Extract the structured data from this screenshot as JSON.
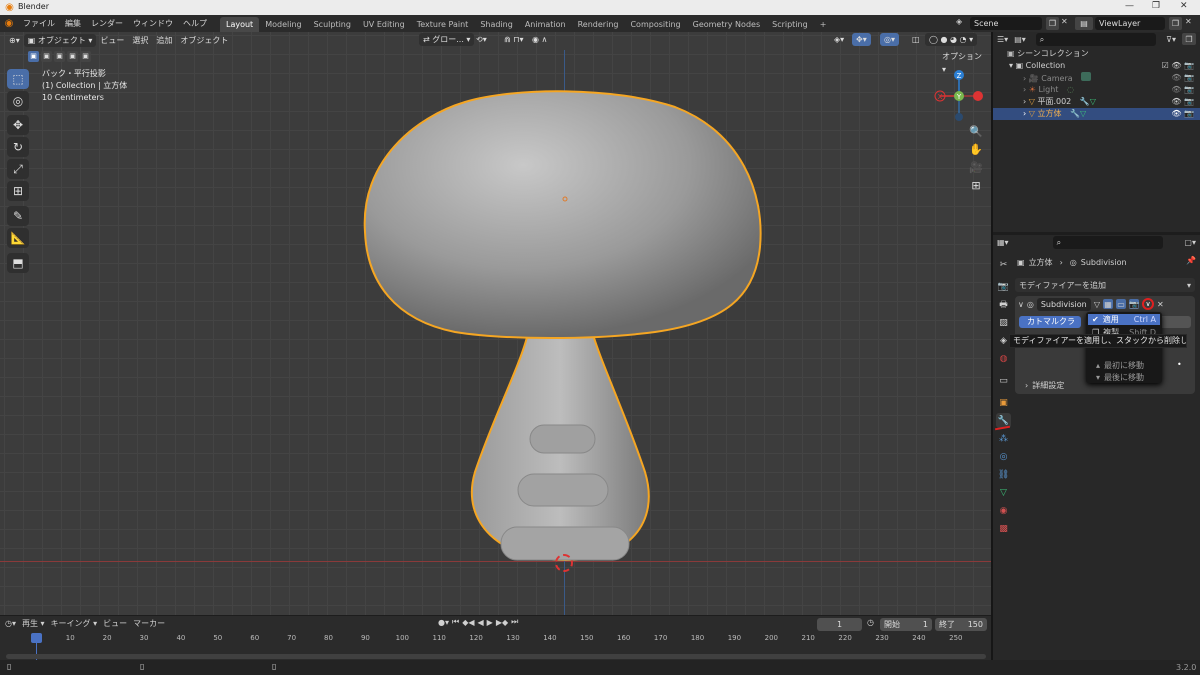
{
  "app": {
    "title": "Blender",
    "version": "3.2.0"
  },
  "menus": [
    "ファイル",
    "編集",
    "レンダー",
    "ウィンドウ",
    "ヘルプ"
  ],
  "workspaces": [
    "Layout",
    "Modeling",
    "Sculpting",
    "UV Editing",
    "Texture Paint",
    "Shading",
    "Animation",
    "Rendering",
    "Compositing",
    "Geometry Nodes",
    "Scripting",
    "+"
  ],
  "scene": "Scene",
  "viewlayer": "ViewLayer",
  "viewport": {
    "mode": "オブジェクト",
    "menus": [
      "ビュー",
      "選択",
      "追加",
      "オブジェクト"
    ],
    "transform": "グロー...",
    "options": "オプション",
    "info_line1": "バック・平行投影",
    "info_line2": "(1) Collection | 立方体",
    "info_line3": "10 Centimeters",
    "gizmo": {
      "z": "Z",
      "y": "Y",
      "x": "X"
    },
    "outline_color": "#f5a623",
    "origin_color": "#e07b2a"
  },
  "outliner": {
    "scene_collection": "シーンコレクション",
    "items": [
      {
        "name": "Collection"
      },
      {
        "name": "Camera"
      },
      {
        "name": "Light"
      },
      {
        "name": "平面.002"
      },
      {
        "name": "立方体"
      }
    ]
  },
  "properties": {
    "breadcrumb_obj": "立方体",
    "breadcrumb_mod": "Subdivision",
    "add_modifier": "モディファイアーを追加",
    "modifier_name": "Subdivision",
    "catmull": "カトマルクラー",
    "advanced": "詳細設定",
    "menu": {
      "apply": "適用",
      "apply_shortcut": "Ctrl A",
      "copy": "複製",
      "copy_shortcut": "Shift D",
      "move_first": "最初に移動",
      "move_last": "最後に移動"
    },
    "tooltip": "モディファイアーを適用し、スタックから削除します。"
  },
  "timeline": {
    "menus": [
      "再生",
      "キーイング",
      "ビュー",
      "マーカー"
    ],
    "current_frame": "1",
    "start_label": "開始",
    "start": "1",
    "end_label": "終了",
    "end": "150",
    "ticks": [
      "1",
      "10",
      "20",
      "30",
      "40",
      "50",
      "60",
      "70",
      "80",
      "90",
      "100",
      "110",
      "120",
      "130",
      "140",
      "150",
      "160",
      "170",
      "180",
      "190",
      "200",
      "210",
      "220",
      "230",
      "240",
      "250"
    ]
  }
}
